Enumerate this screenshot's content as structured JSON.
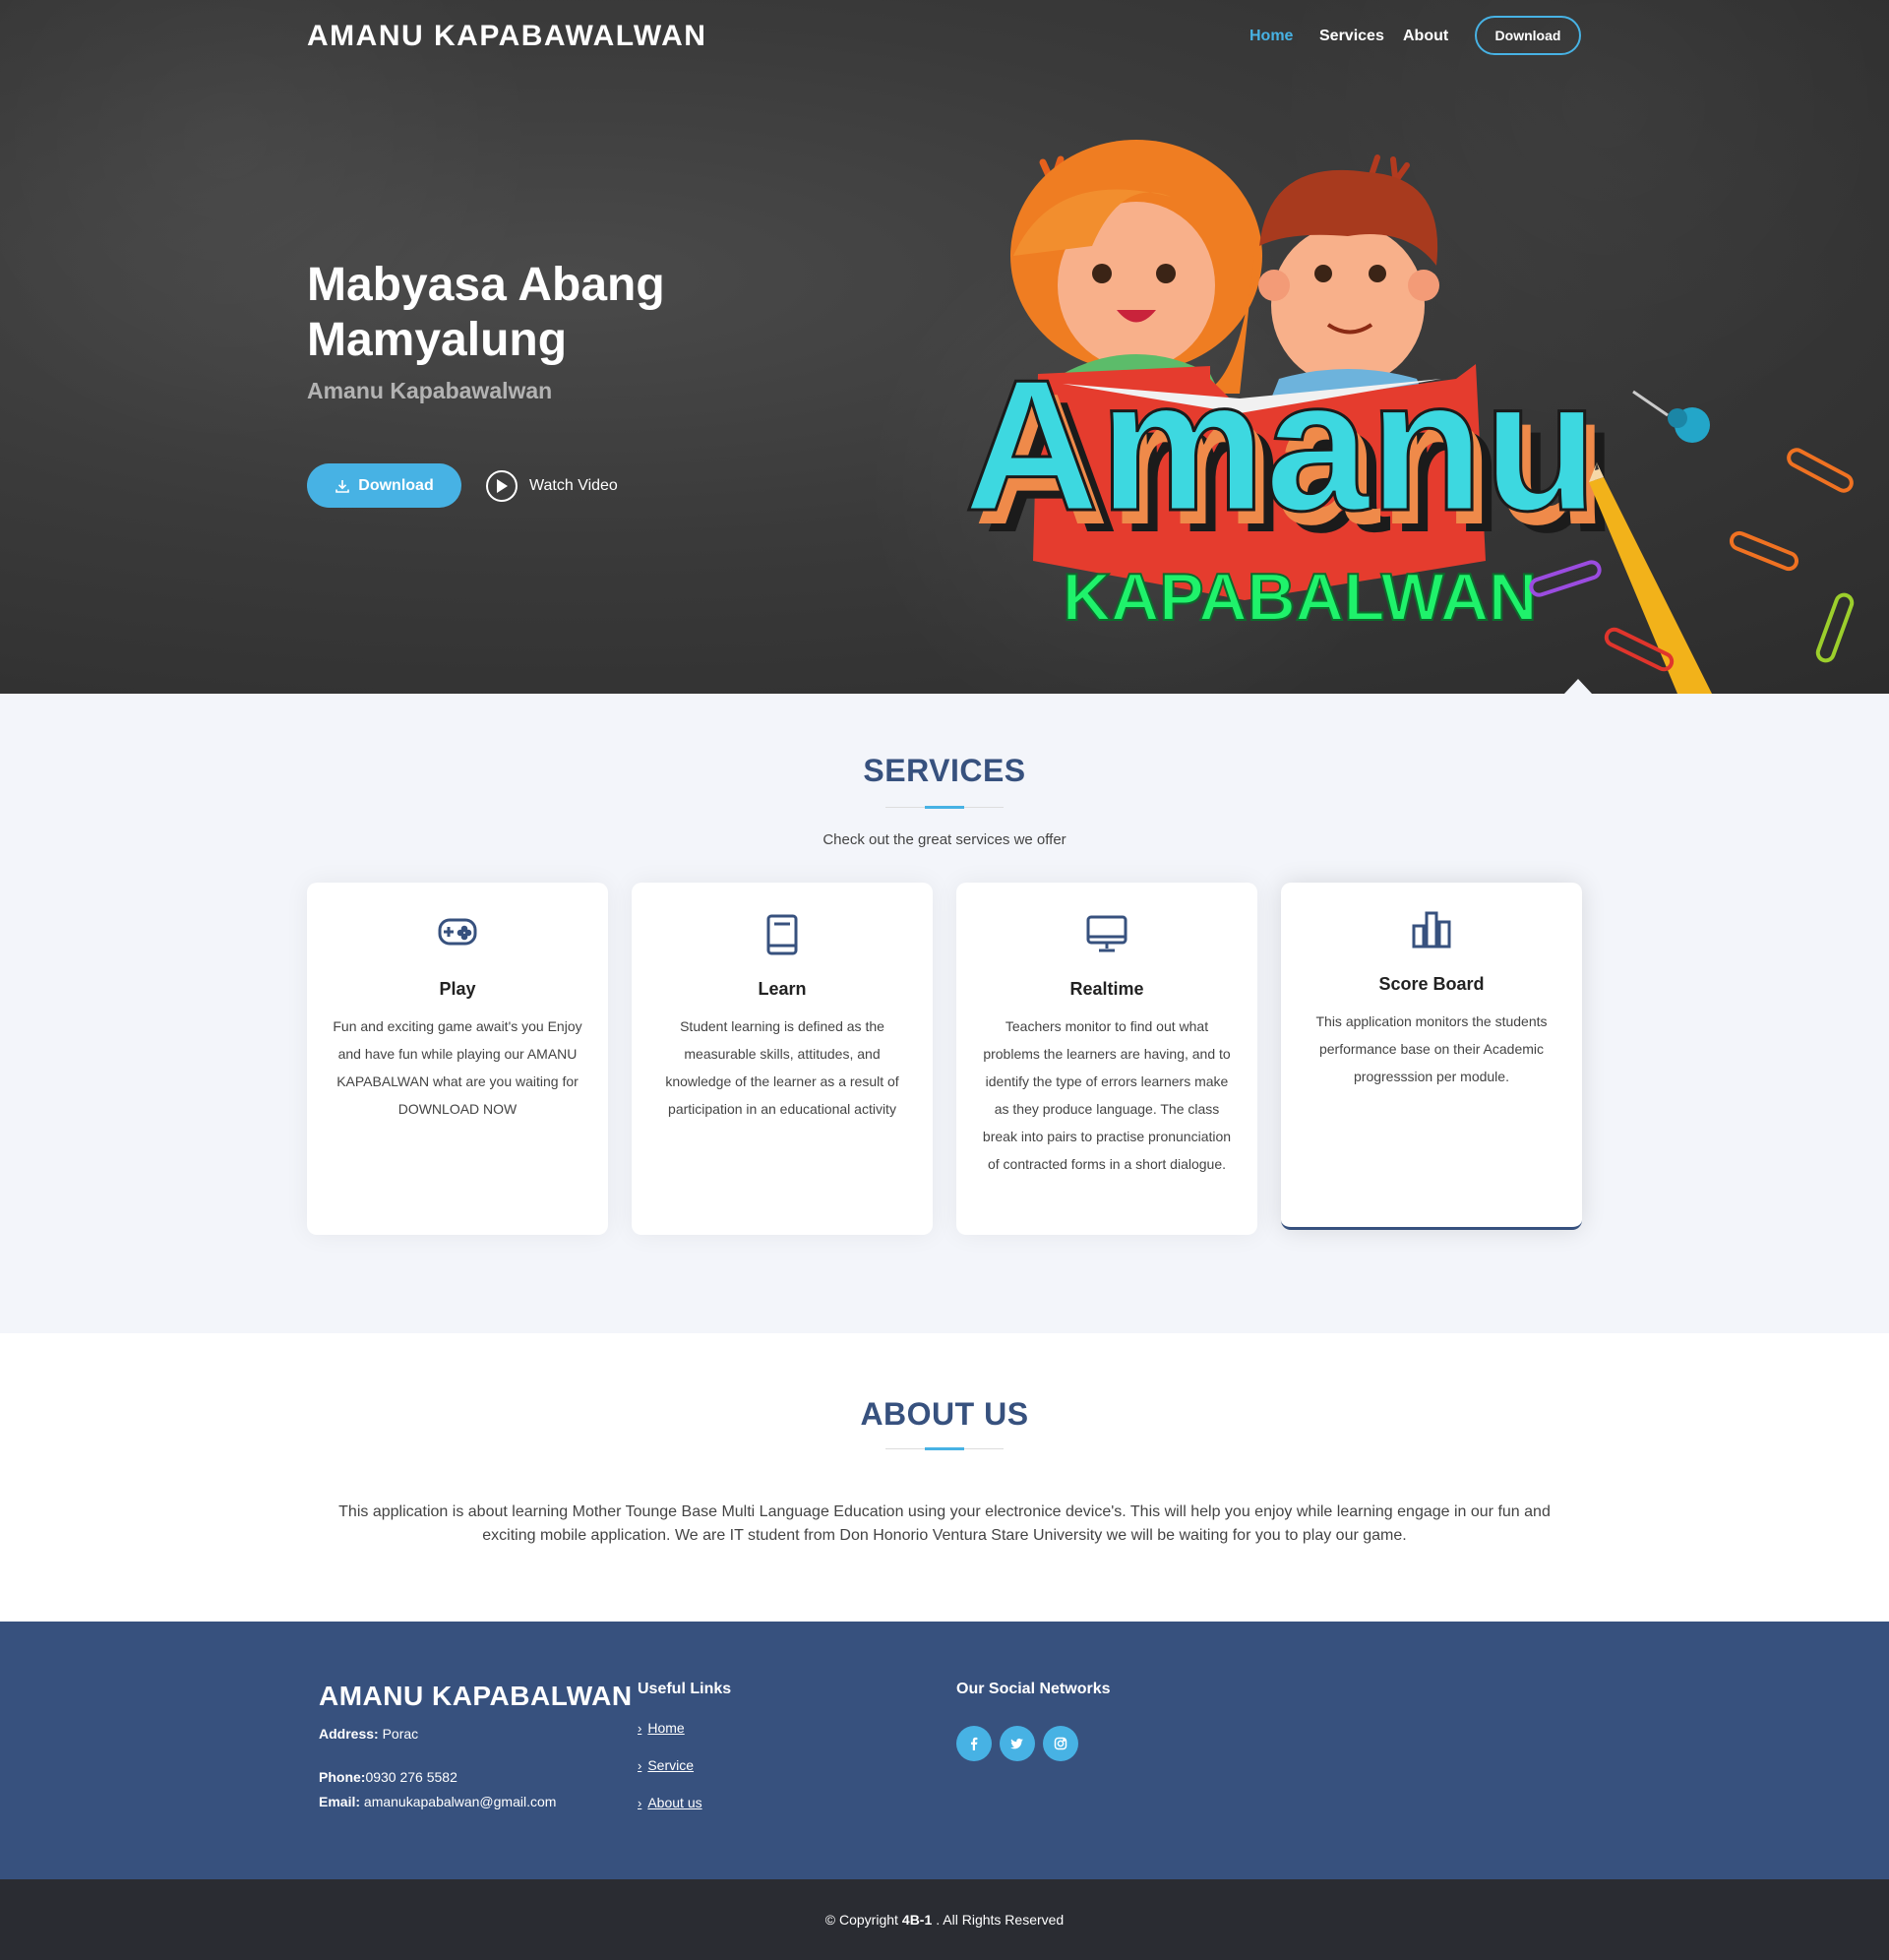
{
  "nav": {
    "brand": "AMANU KAPABAWALWAN",
    "links": [
      "Home",
      "Services",
      "About"
    ],
    "download": "Download"
  },
  "hero": {
    "title": "Mabyasa Abang Mamyalung",
    "subtitle": "Amanu Kapabawalwan",
    "download_button": "Download",
    "watch_video": "Watch Video",
    "logo_word": "Amanu",
    "logo_subword": "KAPABALWAN"
  },
  "services": {
    "title": "SERVICES",
    "description": "Check out the great services we offer",
    "cards": [
      {
        "icon": "gamepad-icon",
        "title": "Play",
        "text": "Fun and exciting game await's you Enjoy and have fun while playing our AMANU KAPABALWAN what are you waiting for DOWNLOAD NOW"
      },
      {
        "icon": "book-icon",
        "title": "Learn",
        "text": "Student learning is defined as the measurable skills, attitudes, and knowledge of the learner as a result of participation in an educational activity"
      },
      {
        "icon": "monitor-icon",
        "title": "Realtime",
        "text": "Teachers monitor to find out what problems the learners are having, and to identify the type of errors learners make as they produce language. The class break into pairs to practise pronunciation of contracted forms in a short dialogue."
      },
      {
        "icon": "bar-chart-icon",
        "title": "Score Board",
        "text": "This application monitors the students performance base on their Academic progresssion per module."
      }
    ]
  },
  "about": {
    "title": "ABOUT US",
    "text": "This application is about learning Mother Tounge Base Multi Language Education using your electronice device's. This will help you enjoy while learning engage in our fun and exciting mobile application. We are IT student from Don Honorio Ventura Stare University we will be waiting for you to play our game."
  },
  "footer": {
    "brand": "AMANU KAPABALWAN",
    "address_label": "Address:",
    "address": "Porac",
    "phone_label": "Phone:",
    "phone": "0930 276 5582",
    "email_label": "Email:",
    "email": "amanukapabalwan@gmail.com",
    "links_heading": "Useful Links",
    "links": [
      "Home",
      "Service",
      "About us"
    ],
    "social_heading": "Our Social Networks",
    "social": [
      "facebook-icon",
      "twitter-icon",
      "instagram-icon"
    ]
  },
  "copyright": {
    "prefix": "© Copyright",
    "owner": "4B-1",
    "suffix": ". All Rights Reserved"
  },
  "colors": {
    "accent": "#47b2e4",
    "primary": "#37517e",
    "services_bg": "#f3f5fa",
    "copyright_bg": "#2a2c32"
  }
}
